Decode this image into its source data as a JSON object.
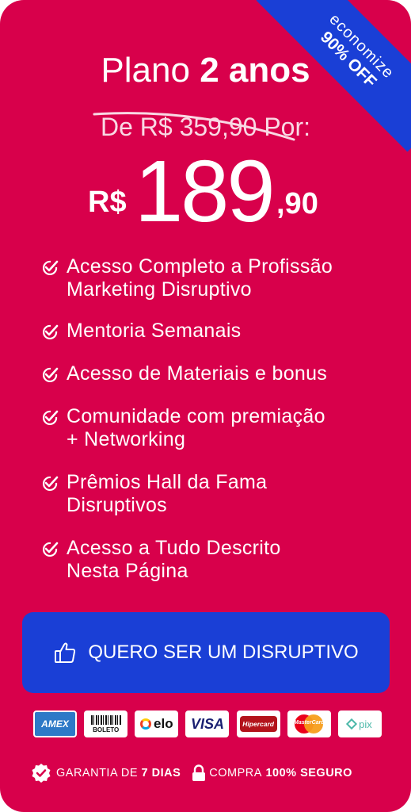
{
  "ribbon": {
    "line1": "economize",
    "line2": "90% OFF"
  },
  "plan": {
    "title_prefix": "Plano",
    "title_bold": "2 anos"
  },
  "pricing": {
    "old_label": "De R$ 359,90 Por:",
    "currency": "R$",
    "amount": "189",
    "cents": ",90"
  },
  "features": [
    "Acesso Completo a Profissão\nMarketing Disruptivo",
    "Mentoria Semanais",
    "Acesso de Materiais  e bonus",
    "Comunidade com premiação\n+ Networking",
    "Prêmios Hall da Fama\nDisruptivos",
    "Acesso a Tudo Descrito\nNesta Página"
  ],
  "cta": {
    "label": "QUERO SER UM DISRUPTIVO"
  },
  "payments": {
    "amex": "AMEX",
    "boleto": "BOLETO",
    "elo": "elo",
    "visa": "VISA",
    "hipercard": "Hipercard",
    "mastercard": "MasterCard",
    "pix": "pix"
  },
  "guarantee": {
    "label": "GARANTIA DE",
    "days": "7 DIAS",
    "secure_label": "COMPRA",
    "secure_bold": "100% SEGURO"
  },
  "colors": {
    "card_bg": "#d8004b",
    "accent_blue": "#1a3fd6"
  }
}
